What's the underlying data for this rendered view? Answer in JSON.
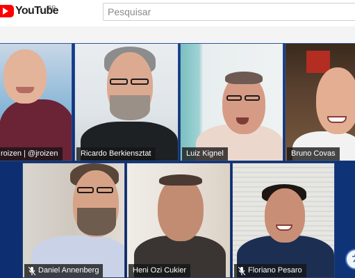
{
  "header": {
    "logo_text": "YouTube",
    "country_code": "BR",
    "search_placeholder": "Pesquisar"
  },
  "participants": [
    {
      "name": "roizen | @jroizen",
      "muted": false
    },
    {
      "name": "Ricardo Berkiensztat",
      "muted": false
    },
    {
      "name": "Luiz Kignel",
      "muted": false
    },
    {
      "name": "Bruno Covas",
      "muted": false
    },
    {
      "name": "Daniel Annenberg",
      "muted": true
    },
    {
      "name": "Heni Ozi Cukier",
      "muted": false
    },
    {
      "name": "Floriano Pesaro",
      "muted": true
    }
  ],
  "icons": {
    "logo": "youtube-play-icon",
    "muted": "mic-muted-icon",
    "corner": "accessibility-icon"
  },
  "colors": {
    "youtube_red": "#ff0000",
    "stage_blue": "#123c8a",
    "name_tag_bg": "#141414"
  }
}
